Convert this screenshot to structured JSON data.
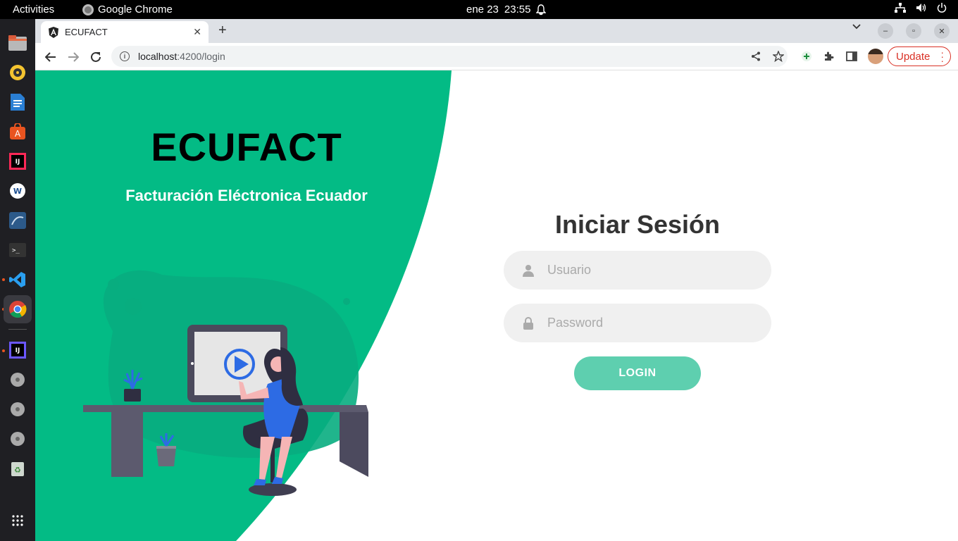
{
  "topbar": {
    "activities": "Activities",
    "app_name": "Google Chrome",
    "date": "ene 23",
    "time": "23:55"
  },
  "dock": {
    "items": [
      "files-icon",
      "rhythmbox-icon",
      "writer-icon",
      "app-center-icon",
      "intellij-icon",
      "webstorm-icon",
      "mysql-workbench-icon",
      "terminal-icon",
      "vscode-icon",
      "chrome-icon",
      "intellij-toolbox-icon",
      "disk-icon",
      "disk-icon",
      "disk-icon",
      "trash-icon",
      "app-grid-icon"
    ]
  },
  "browser": {
    "tab_title": "ECUFACT",
    "url_host": "localhost",
    "url_path": ":4200/login",
    "update_label": "Update"
  },
  "hero": {
    "title": "ECUFACT",
    "subtitle": "Facturación Eléctronica Ecuador",
    "colors": {
      "green": "#03bb85",
      "blob": "#08ad7f",
      "desk": "#5c5a6e",
      "accent_blue": "#2d6be4"
    }
  },
  "login": {
    "title": "Iniciar Sesión",
    "username_placeholder": "Usuario",
    "password_placeholder": "Password",
    "button_label": "LOGIN",
    "colors": {
      "button": "#5ecfaf",
      "field_bg": "#f0f0f0"
    }
  }
}
